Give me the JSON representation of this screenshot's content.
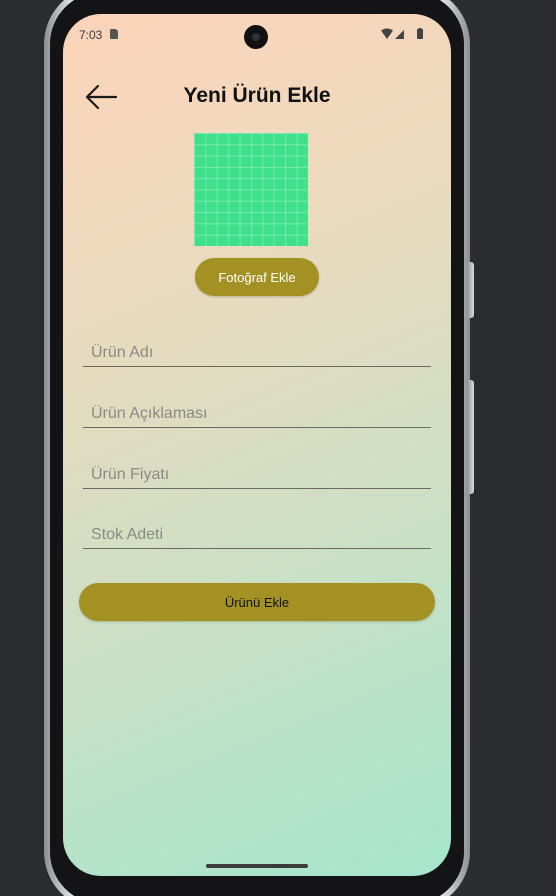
{
  "status_bar": {
    "time": "7:03"
  },
  "header": {
    "title": "Yeni Ürün Ekle"
  },
  "photo": {
    "button_label": "Fotoğraf Ekle"
  },
  "form": {
    "fields": [
      {
        "placeholder": "Ürün Adı",
        "value": ""
      },
      {
        "placeholder": "Ürün Açıklaması",
        "value": ""
      },
      {
        "placeholder": "Ürün Fiyatı",
        "value": ""
      },
      {
        "placeholder": "Stok Adeti",
        "value": ""
      }
    ],
    "submit_label": "Ürünü Ekle"
  },
  "colors": {
    "accent": "#a39223",
    "image_placeholder": "#3ee08c",
    "gradient_top": "#fcd4ba",
    "gradient_bottom": "#a5e6cc"
  },
  "icons": [
    "back-arrow-icon",
    "wifi-icon",
    "signal-icon",
    "battery-icon",
    "sd-card-icon"
  ]
}
